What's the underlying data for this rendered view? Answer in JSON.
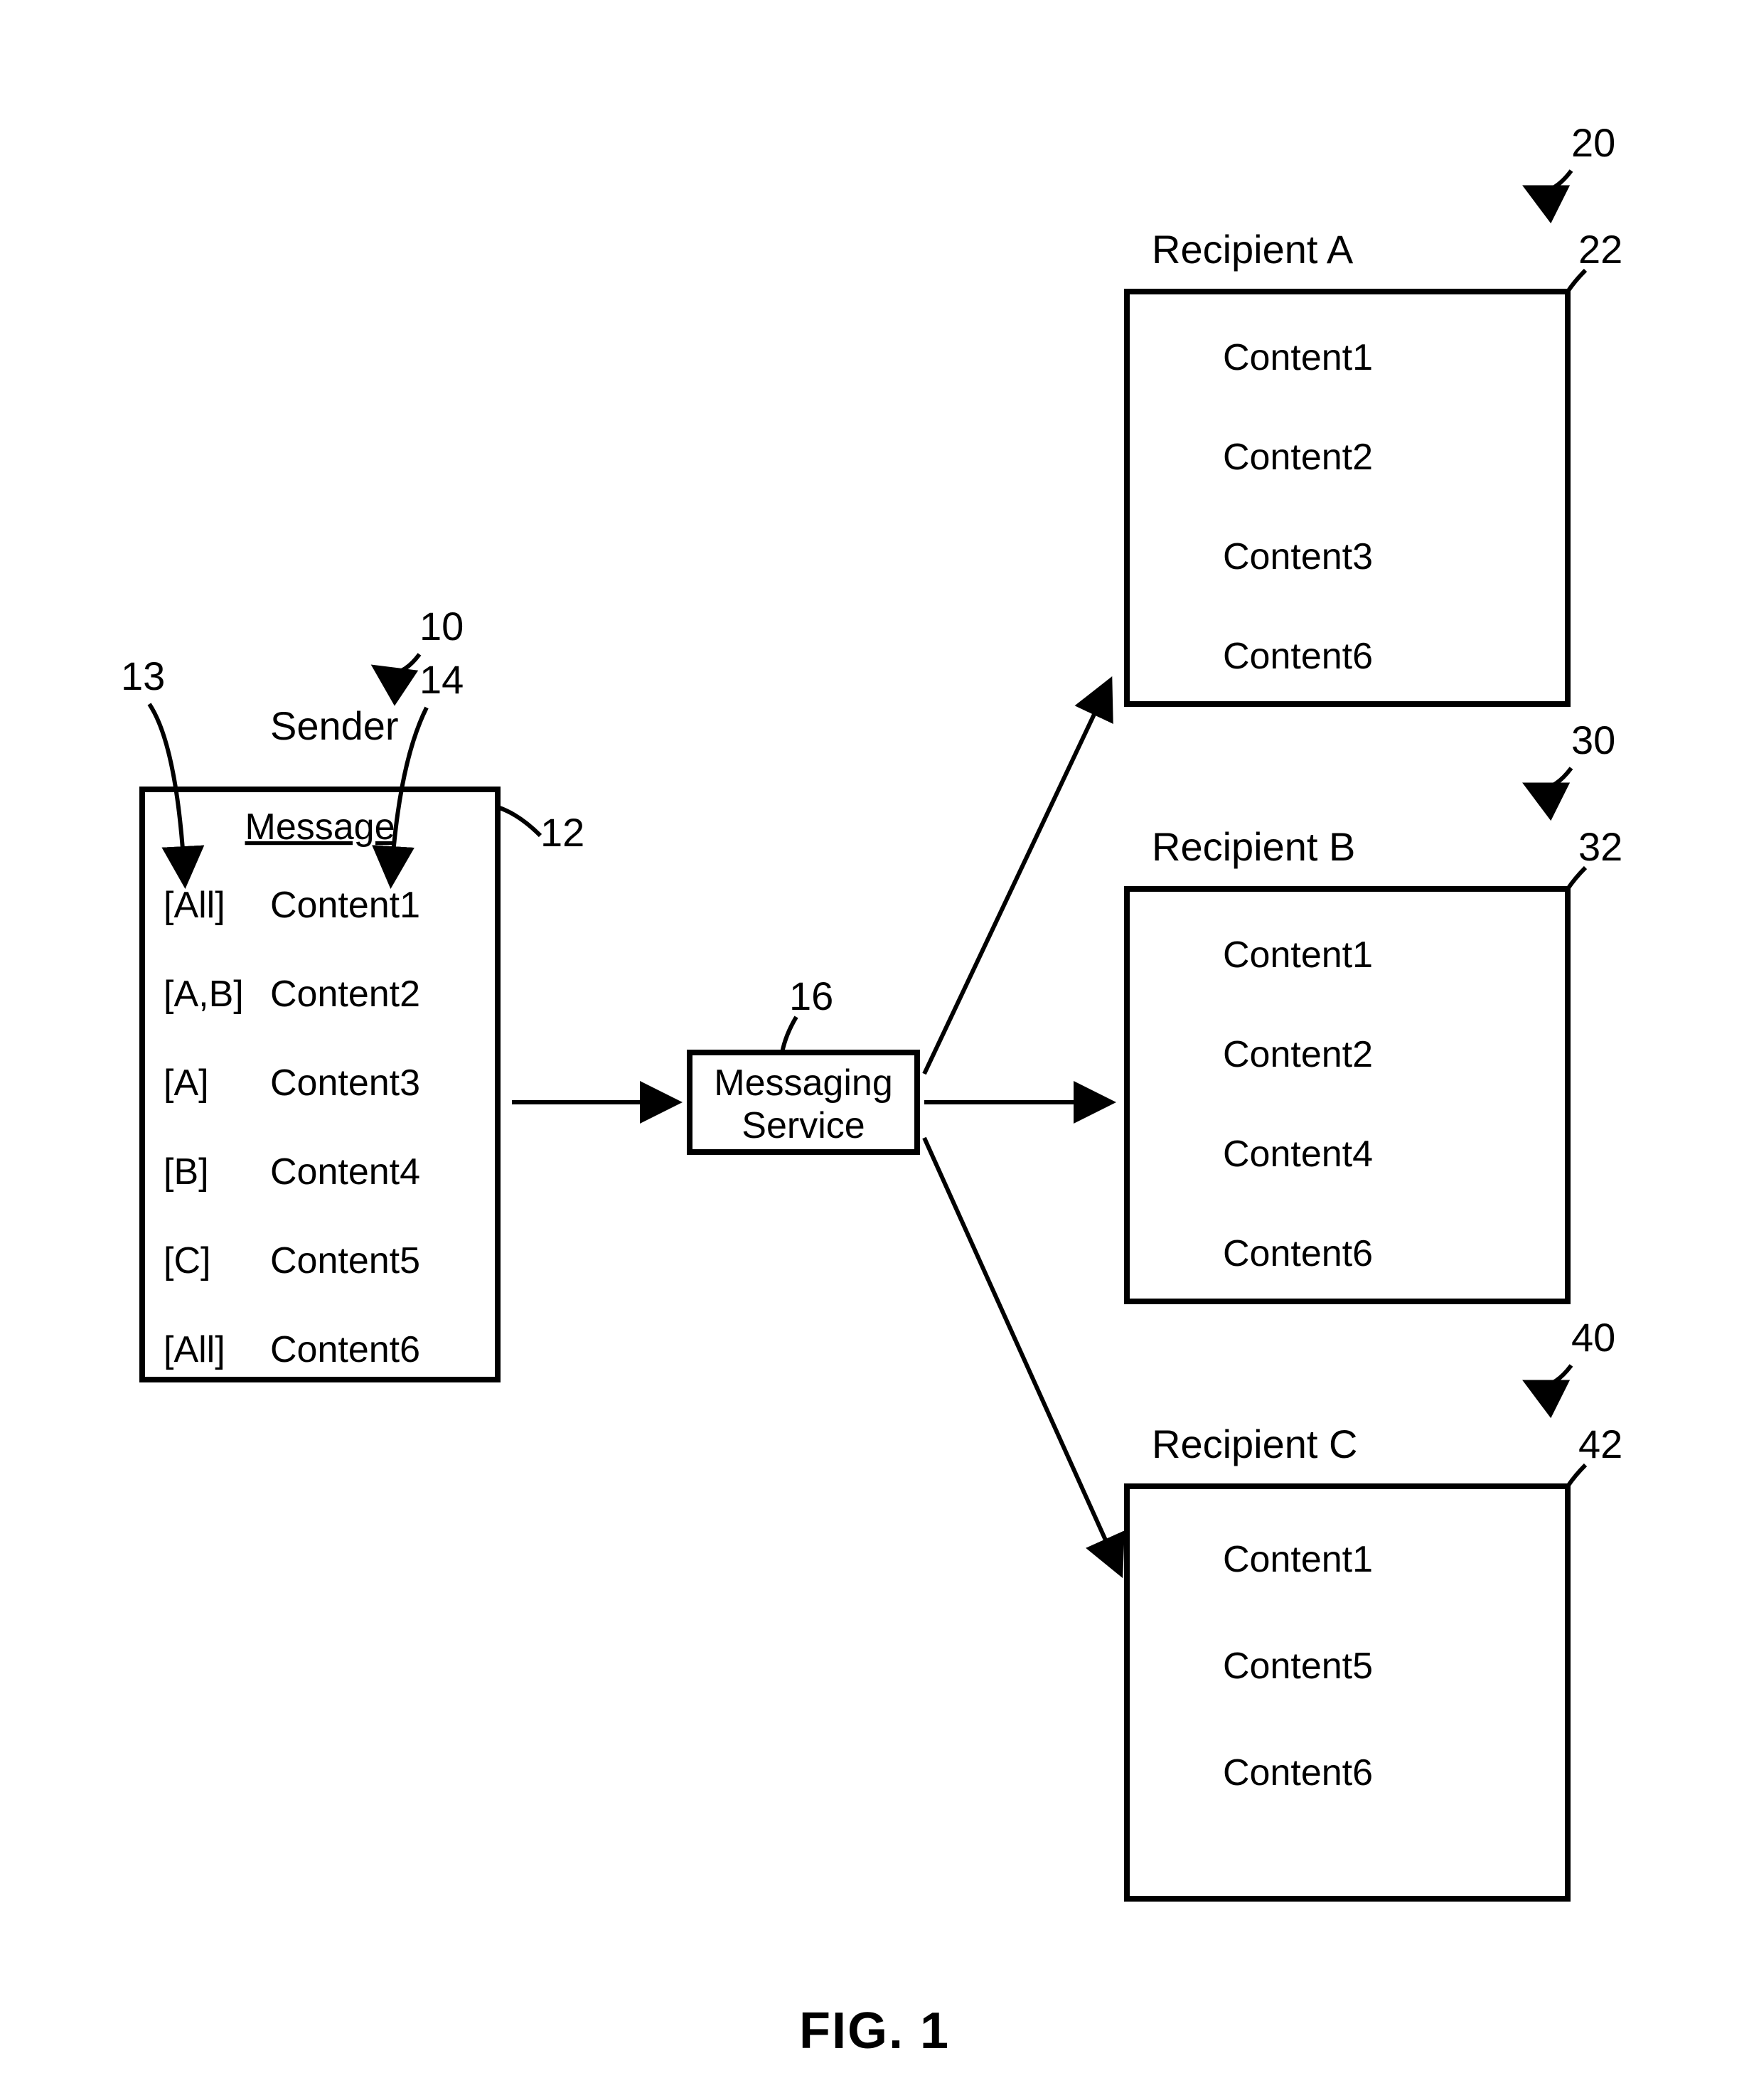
{
  "figure_label": "FIG. 1",
  "sender": {
    "title": "Sender",
    "message_header": "Message",
    "rows": [
      {
        "tag": "[All]",
        "content": "Content1"
      },
      {
        "tag": "[A,B]",
        "content": "Content2"
      },
      {
        "tag": "[A]",
        "content": "Content3"
      },
      {
        "tag": "[B]",
        "content": "Content4"
      },
      {
        "tag": "[C]",
        "content": "Content5"
      },
      {
        "tag": "[All]",
        "content": "Content6"
      }
    ]
  },
  "service": {
    "line1": "Messaging",
    "line2": "Service"
  },
  "recipients": {
    "A": {
      "title": "Recipient A",
      "items": [
        "Content1",
        "Content2",
        "Content3",
        "Content6"
      ]
    },
    "B": {
      "title": "Recipient B",
      "items": [
        "Content1",
        "Content2",
        "Content4",
        "Content6"
      ]
    },
    "C": {
      "title": "Recipient C",
      "items": [
        "Content1",
        "Content5",
        "Content6"
      ]
    }
  },
  "ref_numerals": {
    "n10": "10",
    "n12": "12",
    "n13": "13",
    "n14": "14",
    "n16": "16",
    "n20": "20",
    "n22": "22",
    "n30": "30",
    "n32": "32",
    "n40": "40",
    "n42": "42"
  }
}
